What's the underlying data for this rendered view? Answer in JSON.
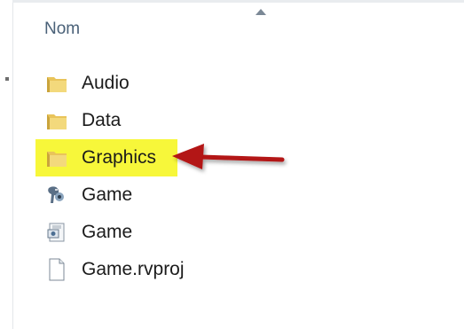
{
  "header": {
    "name_column": "Nom"
  },
  "files": [
    {
      "name": "Audio",
      "icon": "folder-icon",
      "type": "folder",
      "highlighted": false
    },
    {
      "name": "Data",
      "icon": "folder-icon",
      "type": "folder",
      "highlighted": false
    },
    {
      "name": "Graphics",
      "icon": "folder-icon",
      "type": "folder",
      "highlighted": true
    },
    {
      "name": "Game",
      "icon": "game-app-icon",
      "type": "application",
      "highlighted": false
    },
    {
      "name": "Game",
      "icon": "config-file-icon",
      "type": "settings",
      "highlighted": false
    },
    {
      "name": "Game.rvproj",
      "icon": "blank-file-icon",
      "type": "file",
      "highlighted": false
    }
  ],
  "colors": {
    "highlight": "#f7f73a",
    "arrow": "#b31212",
    "header_text": "#4a6178"
  }
}
